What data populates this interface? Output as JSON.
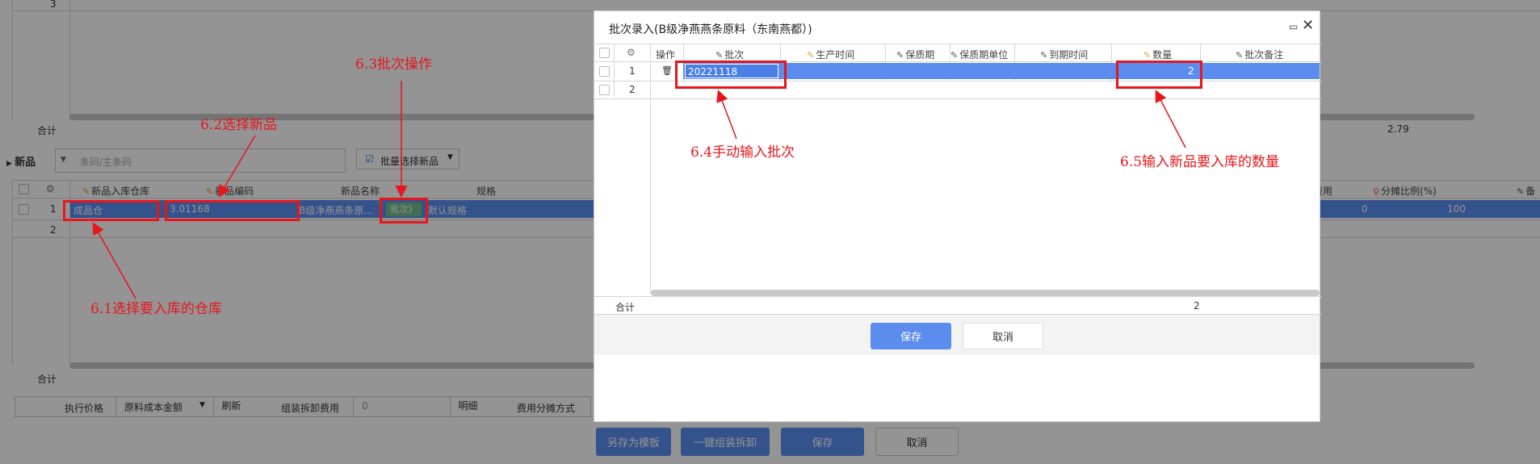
{
  "background": {
    "top_row_num": "3",
    "total_label_top": "合计",
    "total_value_top": "2.79",
    "section_title": "新品",
    "barcode_placeholder": "条码/主条码",
    "batch_select_label": "批量选择新品",
    "columns": [
      "新品入库仓库",
      "新品编码",
      "新品名称",
      "规格"
    ],
    "right_columns": [
      "费用",
      "分摊比例(%)"
    ],
    "row": {
      "num": "1",
      "warehouse": "成品仓",
      "code": "3.01168",
      "name": "B级净燕燕条原...",
      "batch_btn": "批次》",
      "spec": "默认规格",
      "fee": "0",
      "ratio": "100"
    },
    "row2_num": "2",
    "total_label_bottom": "合计",
    "footer": {
      "price_label": "执行价格",
      "price_select": "原料成本金额",
      "refresh": "刷新",
      "assembly_label": "组装拆卸费用",
      "assembly_value": "0",
      "detail": "明细",
      "alloc_label": "费用分摊方式"
    },
    "buttons": {
      "save_template": "另存为模板",
      "one_key": "一键组装拆卸",
      "save": "保存",
      "cancel": "取消"
    }
  },
  "modal": {
    "title": "批次录入(B级净燕燕条原料（东南燕都）)",
    "columns": [
      "操作",
      "批次",
      "生产时间",
      "保质期",
      "保质期单位",
      "到期时间",
      "数量",
      "批次备注"
    ],
    "rows": [
      {
        "num": "1",
        "batch": "20221118",
        "qty": "2"
      },
      {
        "num": "2",
        "batch": "",
        "qty": ""
      }
    ],
    "total_label": "合计",
    "total_qty": "2",
    "save": "保存",
    "cancel": "取消"
  },
  "annotations": {
    "a61": "6.1选择要入库的仓库",
    "a62": "6.2选择新品",
    "a63": "6.3批次操作",
    "a64": "6.4手动输入批次",
    "a65": "6.5输入新品要入库的数量"
  },
  "colors": {
    "accent": "#5b8def",
    "annotation": "#e8151b",
    "overlay": "rgba(0,0,0,0.42)"
  }
}
